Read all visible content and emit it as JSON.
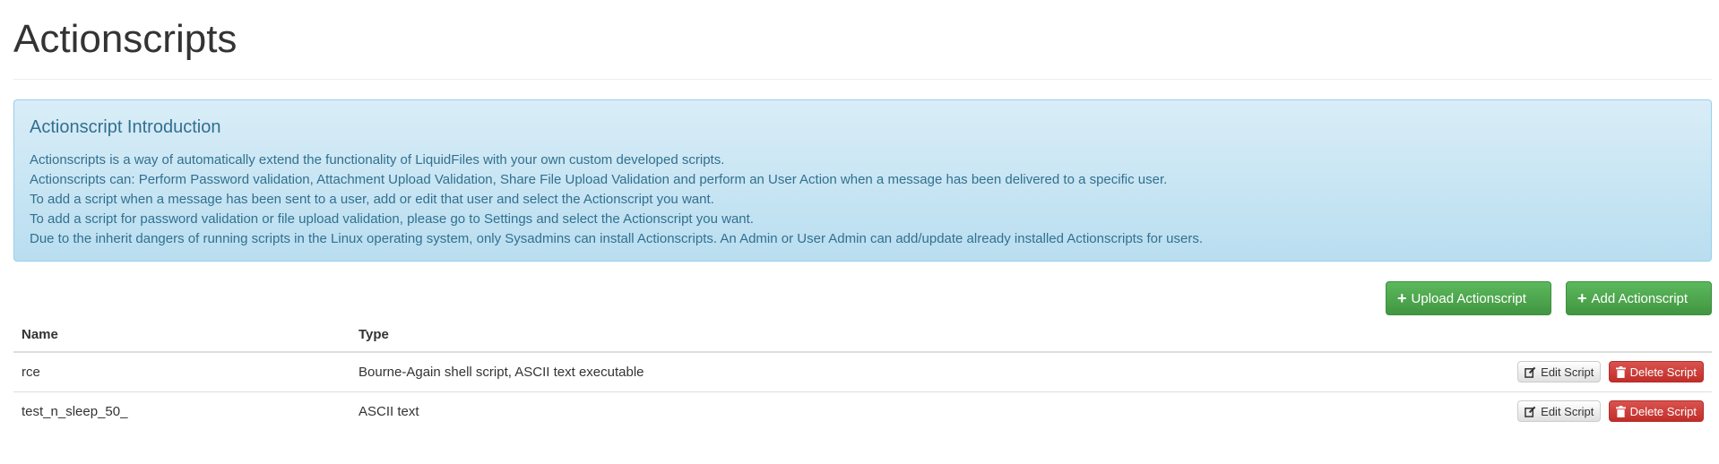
{
  "header": {
    "title": "Actionscripts"
  },
  "intro": {
    "heading": "Actionscript Introduction",
    "lines": [
      "Actionscripts is a way of automatically extend the functionality of LiquidFiles with your own custom developed scripts.",
      "Actionscripts can: Perform Password validation, Attachment Upload Validation, Share File Upload Validation and perform an User Action when a message has been delivered to a specific user.",
      "To add a script when a message has been sent to a user, add or edit that user and select the Actionscript you want.",
      "To add a script for password validation or file upload validation, please go to Settings and select the Actionscript you want.",
      "Due to the inherit dangers of running scripts in the Linux operating system, only Sysadmins can install Actionscripts. An Admin or User Admin can add/update already installed Actionscripts for users."
    ]
  },
  "toolbar": {
    "upload_label": "Upload Actionscript",
    "add_label": "Add Actionscript",
    "plus_icon": "plus-icon"
  },
  "table": {
    "headers": {
      "name": "Name",
      "type": "Type"
    },
    "rows": [
      {
        "name": "rce",
        "type": "Bourne-Again shell script, ASCII text executable"
      },
      {
        "name": "test_n_sleep_50_",
        "type": "ASCII text"
      }
    ],
    "edit_label": "Edit Script",
    "delete_label": "Delete Script",
    "edit_icon": "edit-icon",
    "delete_icon": "trash-icon"
  },
  "colors": {
    "info_text": "#31708f",
    "info_bg": "#d9edf7",
    "success": "#5cb85c",
    "danger": "#d9534f"
  }
}
